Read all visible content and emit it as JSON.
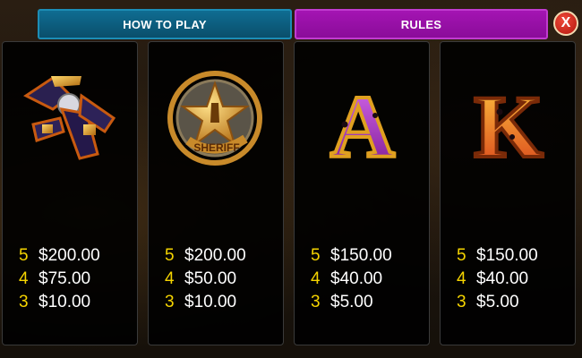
{
  "tabs": {
    "how_to_play": "HOW TO PLAY",
    "rules": "RULES"
  },
  "close_label": "X",
  "colors": {
    "count": "#f5d400",
    "tab_how_to_play": "#0f6d92",
    "tab_rules": "#a414b3"
  },
  "symbols": [
    {
      "icon": "gun-holster-icon",
      "payouts": [
        {
          "count": "5",
          "amount": "$200.00"
        },
        {
          "count": "4",
          "amount": "$75.00"
        },
        {
          "count": "3",
          "amount": "$10.00"
        }
      ]
    },
    {
      "icon": "sheriff-badge-icon",
      "badge_text": "SHERIFF",
      "payouts": [
        {
          "count": "5",
          "amount": "$200.00"
        },
        {
          "count": "4",
          "amount": "$50.00"
        },
        {
          "count": "3",
          "amount": "$10.00"
        }
      ]
    },
    {
      "icon": "letter-a-icon",
      "letter": "A",
      "payouts": [
        {
          "count": "5",
          "amount": "$150.00"
        },
        {
          "count": "4",
          "amount": "$40.00"
        },
        {
          "count": "3",
          "amount": "$5.00"
        }
      ]
    },
    {
      "icon": "letter-k-icon",
      "letter": "K",
      "payouts": [
        {
          "count": "5",
          "amount": "$150.00"
        },
        {
          "count": "4",
          "amount": "$40.00"
        },
        {
          "count": "3",
          "amount": "$5.00"
        }
      ]
    }
  ]
}
